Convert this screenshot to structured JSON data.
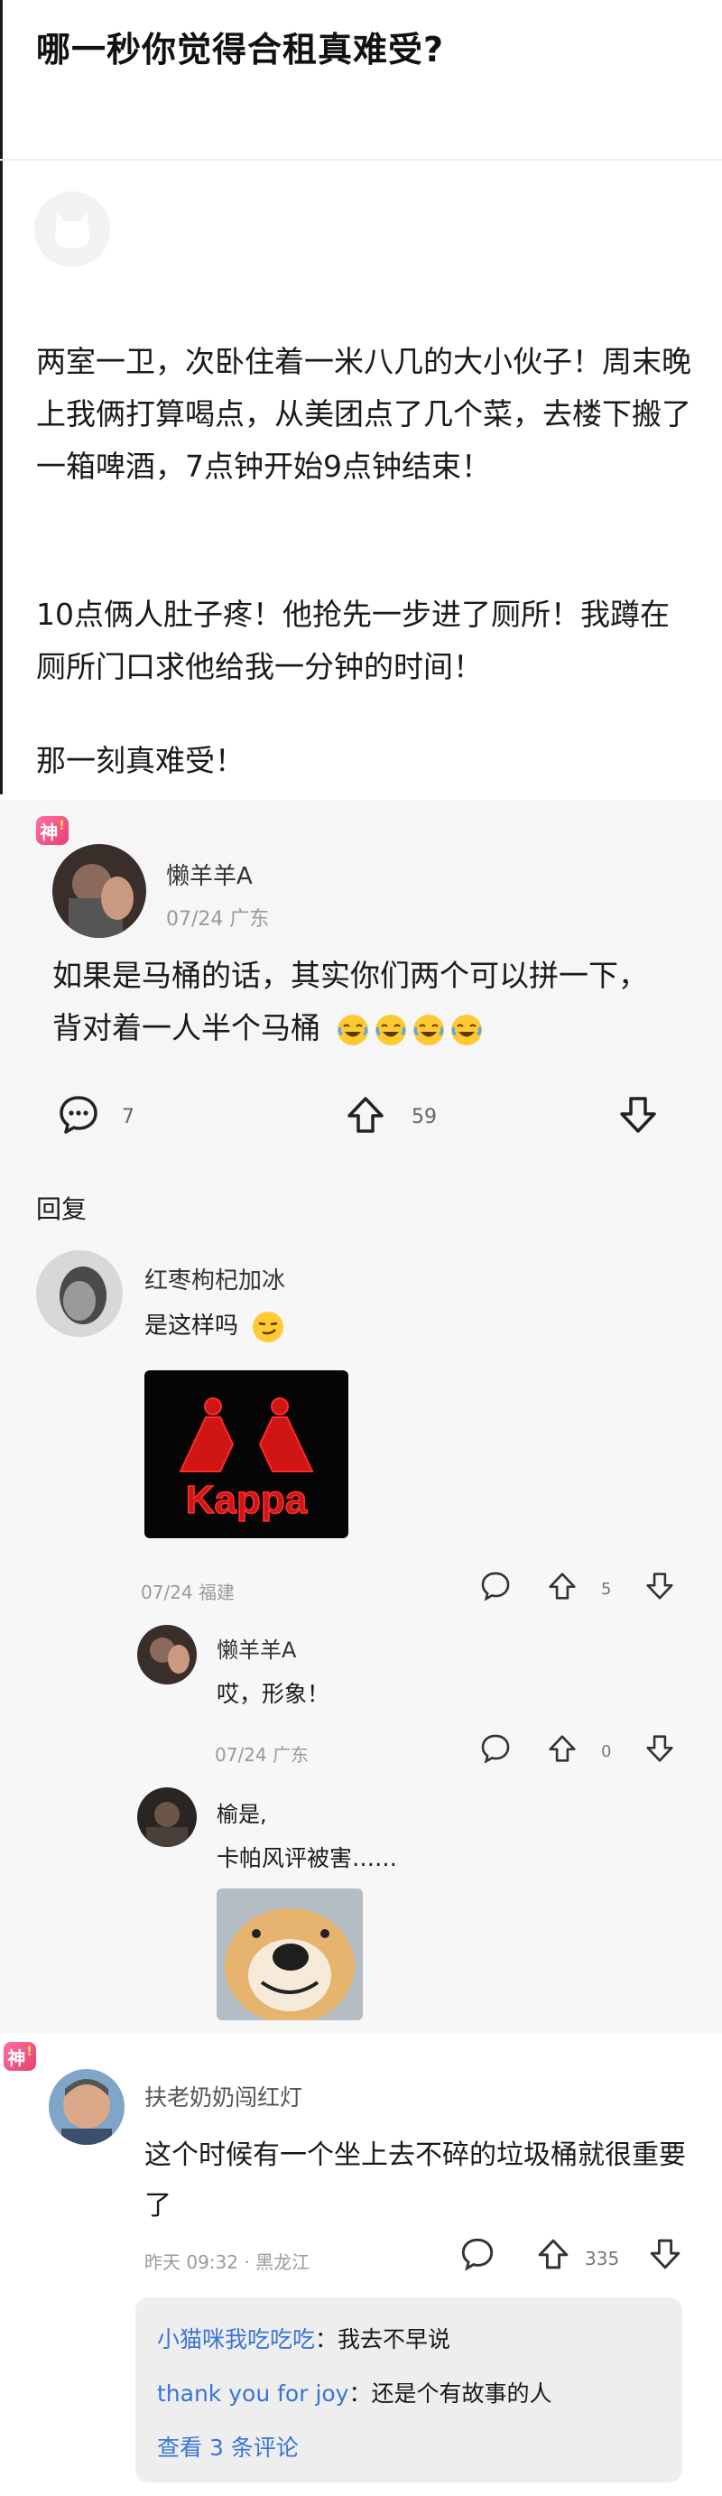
{
  "post": {
    "title": "哪一秒你觉得合租真难受?",
    "paragraphs": [
      "两室一卫，次卧住着一米八几的大小伙子！周末晚上我俩打算喝点，从美团点了几个菜，去楼下搬了一箱啤酒，7点钟开始9点钟结束！",
      "10点俩人肚子疼！他抢先一步进了厕所！我蹲在厕所门口求他给我一分钟的时间！",
      "那一刻真难受！"
    ]
  },
  "top_comment": {
    "badge": "神",
    "username": "懒羊羊A",
    "meta": "07/24 广东",
    "text": "如果是马桶的话，其实你们两个可以拼一下，背对着一人半个马桶",
    "emoji_icons": [
      "laughing-tears-icon",
      "laughing-tears-icon",
      "laughing-tears-icon",
      "laughing-tears-icon"
    ],
    "comment_count": "7",
    "like_count": "59"
  },
  "replies_header": "回复",
  "replies": [
    {
      "username": "红枣枸杞加冰",
      "text": "是这样吗",
      "emoji_icon": "smirk-face-icon",
      "image_logo_text": "Kappa",
      "meta": "07/24 福建",
      "like_count": "5"
    },
    {
      "username": "懒羊羊A",
      "text": "哎，形象！",
      "meta": "07/24 广东",
      "like_count": "0"
    },
    {
      "username": "榆是,",
      "text": "卡帕风评被害……"
    }
  ],
  "second_comment": {
    "badge": "神",
    "username": "扶老奶奶闯红灯",
    "text": "这个时候有一个坐上去不碎的垃圾桶就很重要了",
    "meta": "昨天 09:32 · 黑龙江",
    "like_count": "335",
    "sub_replies": [
      {
        "name": "小猫咪我吃吃吃",
        "sep": "：",
        "text": "我去不早说"
      },
      {
        "name": "thank you for joy",
        "sep": "：",
        "text": "还是个有故事的人"
      }
    ],
    "view_more": "查看 3 条评论"
  },
  "colors": {
    "accent_link": "#3a74d6",
    "badge_pink": "#e7416c",
    "panel_gray": "#f6f6f6"
  }
}
